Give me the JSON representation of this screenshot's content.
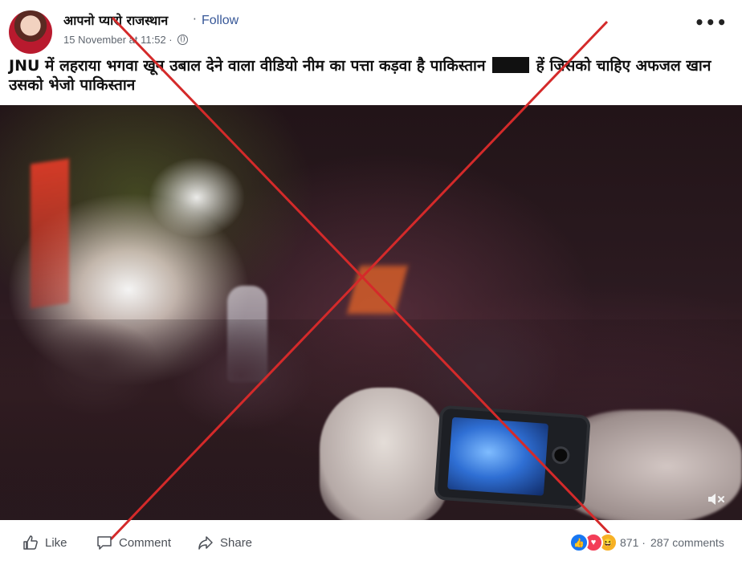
{
  "post": {
    "page_name": "आपनो प्यारो राजस्थान",
    "follow_separator": "·",
    "follow_label": "Follow",
    "timestamp": "15 November at 11:52 ·",
    "more_label": "•••",
    "text": "JNU में लहराया भगवा खून उबाल देने वाला वीडियो नीम का पत्ता कड़वा है पाकिस्तान",
    "text_after_redaction": "हें जिसको चाहिए अफजल खान उसको भेजो पाकिस्तान"
  },
  "video": {
    "mute_icon": "speaker-muted-icon",
    "mute_glyph": "🔇"
  },
  "overlay": {
    "x_color": "#d42a2a"
  },
  "actions": {
    "like_label": "Like",
    "comment_label": "Comment",
    "share_label": "Share"
  },
  "reactions": {
    "icons": [
      "like-icon",
      "love-icon",
      "haha-icon"
    ],
    "like_glyph": "👍",
    "love_glyph": "♥",
    "haha_glyph": "😆",
    "count": "871",
    "separator": "·",
    "comments": "287 comments"
  },
  "colors": {
    "link": "#385898",
    "like": "#1877f2",
    "love": "#f33e58",
    "haha": "#f7b125"
  }
}
